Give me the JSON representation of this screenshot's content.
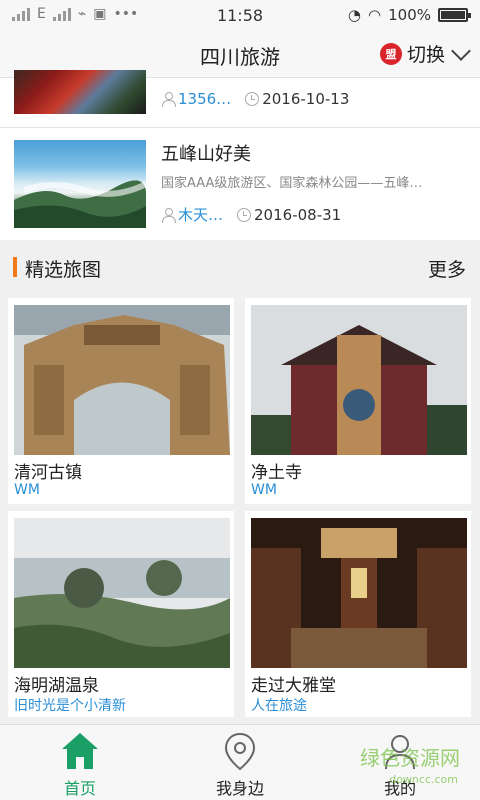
{
  "status": {
    "carrier": "E",
    "time": "11:58",
    "battery": "100%"
  },
  "header": {
    "title": "四川旅游",
    "switch_logo": "盟",
    "switch_label": "切换"
  },
  "articles": [
    {
      "title": "",
      "subtitle": "",
      "author": "1356…",
      "date": "2016-10-13"
    },
    {
      "title": "五峰山好美",
      "subtitle": "国家AAA级旅游区、国家森林公园——五峰…",
      "author": "木天…",
      "date": "2016-08-31"
    }
  ],
  "section": {
    "title": "精选旅图",
    "more": "更多"
  },
  "cards": [
    {
      "title": "清河古镇",
      "author": "WM"
    },
    {
      "title": "净土寺",
      "author": "WM"
    },
    {
      "title": "海明湖温泉",
      "author": "旧时光是个小清新"
    },
    {
      "title": "走过大雅堂",
      "author": "人在旅途"
    }
  ],
  "nav": [
    {
      "label": "首页",
      "icon": "home-icon",
      "active": true
    },
    {
      "label": "我身边",
      "icon": "location-pin-icon",
      "active": false
    },
    {
      "label": "我的",
      "icon": "user-icon",
      "active": false
    }
  ],
  "watermark": {
    "text": "绿色资源网",
    "url": "downcc.com"
  },
  "colors": {
    "accent_green": "#1aa066",
    "link_blue": "#2a8fd6",
    "section_orange": "#f07a1a"
  }
}
